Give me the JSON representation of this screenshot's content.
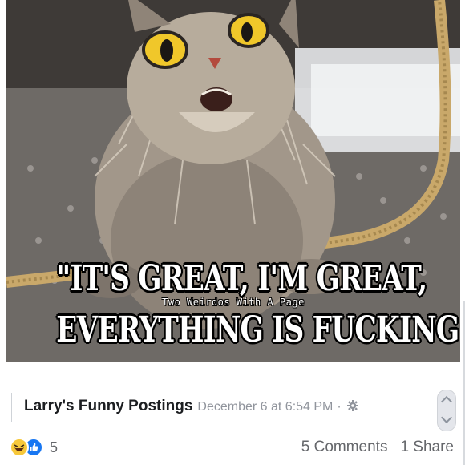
{
  "meme": {
    "caption_line1": "\"IT'S GREAT, I'M GREAT,",
    "caption_line2": "EVERYTHING IS FUCKING GREAT!!\"",
    "watermark": "Two Weirdos With A Page"
  },
  "post": {
    "page_name": "Larry's Funny Postings",
    "timestamp": "December 6 at 6:54 PM",
    "separator": "·",
    "audience_icon": "gear-icon"
  },
  "footer": {
    "reaction_icons": [
      "haha-reaction-icon",
      "like-reaction-icon"
    ],
    "reaction_count": "5",
    "comments": "5 Comments",
    "shares": "1 Share"
  },
  "colors": {
    "like_blue": "#1877f2",
    "haha_yellow": "#f7c83a",
    "meta_gray": "#90949c",
    "text_dark": "#1c1e21"
  }
}
